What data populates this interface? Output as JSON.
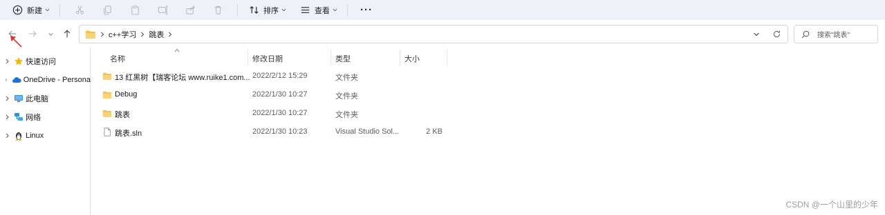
{
  "toolbar": {
    "new_label": "新建",
    "sort_label": "排序",
    "view_label": "查看",
    "more_label": "···"
  },
  "address": {
    "crumbs": [
      "c++学习",
      "跳表"
    ]
  },
  "search": {
    "placeholder": "搜索\"跳表\""
  },
  "sidebar": {
    "items": [
      {
        "label": "快速访问",
        "icon": "star-icon"
      },
      {
        "label": "OneDrive - Persona",
        "icon": "cloud-icon"
      },
      {
        "label": "此电脑",
        "icon": "monitor-icon"
      },
      {
        "label": "网络",
        "icon": "network-icon"
      },
      {
        "label": "Linux",
        "icon": "linux-penguin-icon"
      }
    ]
  },
  "columns": {
    "name": "名称",
    "date": "修改日期",
    "type": "类型",
    "size": "大小"
  },
  "files": [
    {
      "name": "13 红黑树【瑞客论坛 www.ruike1.com...",
      "date": "2022/2/12 15:29",
      "type": "文件夹",
      "size": "",
      "icon": "folder-icon"
    },
    {
      "name": "Debug",
      "date": "2022/1/30 10:27",
      "type": "文件夹",
      "size": "",
      "icon": "folder-icon"
    },
    {
      "name": "跳表",
      "date": "2022/1/30 10:27",
      "type": "文件夹",
      "size": "",
      "icon": "folder-icon"
    },
    {
      "name": "跳表.sln",
      "date": "2022/1/30 10:23",
      "type": "Visual Studio Sol...",
      "size": "2 KB",
      "icon": "file-icon"
    }
  ],
  "watermark": "CSDN @一个山里的少年",
  "colors": {
    "toolbar_bg": "#eef1f8",
    "folder": "#f4c04f",
    "accent_red": "#e0322f"
  }
}
